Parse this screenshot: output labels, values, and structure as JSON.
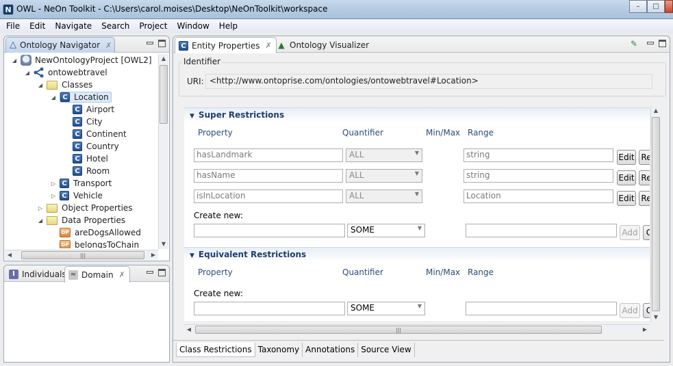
{
  "window": {
    "app_icon": "N",
    "title": "OWL - NeOn Toolkit - C:\\Users\\carol.moises\\Desktop\\NeOnToolkit\\workspace",
    "minimize": "–",
    "maximize": "□",
    "close": "×"
  },
  "menu": [
    "File",
    "Edit",
    "Navigate",
    "Search",
    "Project",
    "Window",
    "Help"
  ],
  "navigator": {
    "tab_label": "Ontology Navigator",
    "close_glyph": "✗",
    "tree": [
      {
        "label": "NewOntologyProject [OWL2]",
        "icon": "project-icon",
        "level": 0,
        "twisty": "expanded"
      },
      {
        "label": "ontowebtravel",
        "icon": "ontology-icon",
        "level": 1,
        "twisty": "expanded"
      },
      {
        "label": "Classes",
        "icon": "folder-icon",
        "level": 2,
        "twisty": "expanded"
      },
      {
        "label": "Location",
        "icon": "class-icon",
        "level": 3,
        "twisty": "expanded",
        "selected": true
      },
      {
        "label": "Airport",
        "icon": "class-icon",
        "level": 4,
        "twisty": "none"
      },
      {
        "label": "City",
        "icon": "class-icon",
        "level": 4,
        "twisty": "none"
      },
      {
        "label": "Continent",
        "icon": "class-icon",
        "level": 4,
        "twisty": "none"
      },
      {
        "label": "Country",
        "icon": "class-icon",
        "level": 4,
        "twisty": "none"
      },
      {
        "label": "Hotel",
        "icon": "class-icon",
        "level": 4,
        "twisty": "none"
      },
      {
        "label": "Room",
        "icon": "class-icon",
        "level": 4,
        "twisty": "none"
      },
      {
        "label": "Transport",
        "icon": "class-icon",
        "level": 3,
        "twisty": "collapsed"
      },
      {
        "label": "Vehicle",
        "icon": "class-icon",
        "level": 3,
        "twisty": "collapsed"
      },
      {
        "label": "Object Properties",
        "icon": "folder-icon",
        "level": 2,
        "twisty": "collapsed"
      },
      {
        "label": "Data Properties",
        "icon": "folder-icon",
        "level": 2,
        "twisty": "expanded"
      },
      {
        "label": "areDogsAllowed",
        "icon": "data-property-icon",
        "level": 3,
        "twisty": "none"
      },
      {
        "label": "belongsToChain",
        "icon": "data-property-icon",
        "level": 3,
        "twisty": "none"
      }
    ]
  },
  "lower_panel": {
    "tabs": [
      {
        "label": "Individuals",
        "icon": "individuals-icon"
      },
      {
        "label": "Domain",
        "icon": "domain-icon",
        "active": true
      }
    ],
    "close_glyph": "✗"
  },
  "editor": {
    "tabs": [
      {
        "label": "Entity Properties",
        "icon": "class-icon",
        "active": true
      },
      {
        "label": "Ontology Visualizer",
        "icon": "visualizer-icon"
      }
    ],
    "close_glyph": "✗",
    "identifier": {
      "group_label": "Identifier",
      "uri_label": "URI:",
      "uri_value": "<http://www.ontoprise.com/ontologies/ontowebtravel#Location>"
    },
    "super_restrictions": {
      "title": "Super Restrictions",
      "columns": [
        "Property",
        "Quantifier",
        "Min/Max",
        "Range"
      ],
      "rows": [
        {
          "property": "hasLandmark",
          "quantifier": "ALL",
          "minmax": "",
          "range": "string",
          "edit": "Edit",
          "remove": "Re"
        },
        {
          "property": "hasName",
          "quantifier": "ALL",
          "minmax": "",
          "range": "string",
          "edit": "Edit",
          "remove": "Re"
        },
        {
          "property": "isInLocation",
          "quantifier": "ALL",
          "minmax": "",
          "range": "Location",
          "edit": "Edit",
          "remove": "Re"
        }
      ],
      "create_new_label": "Create new:",
      "new_property": "",
      "new_quantifier": "SOME",
      "new_range": "",
      "add_label": "Add",
      "clear_label": "C"
    },
    "equivalent_restrictions": {
      "title": "Equivalent Restrictions",
      "columns": [
        "Property",
        "Quantifier",
        "Min/Max",
        "Range"
      ],
      "create_new_label": "Create new:",
      "new_property": "",
      "new_quantifier": "SOME",
      "new_range": "",
      "add_label": "Add",
      "clear_label": "C"
    },
    "bottom_tabs": [
      {
        "label": "Class Restrictions",
        "active": true
      },
      {
        "label": "Taxonomy"
      },
      {
        "label": "Annotations"
      },
      {
        "label": "Source View"
      }
    ]
  }
}
